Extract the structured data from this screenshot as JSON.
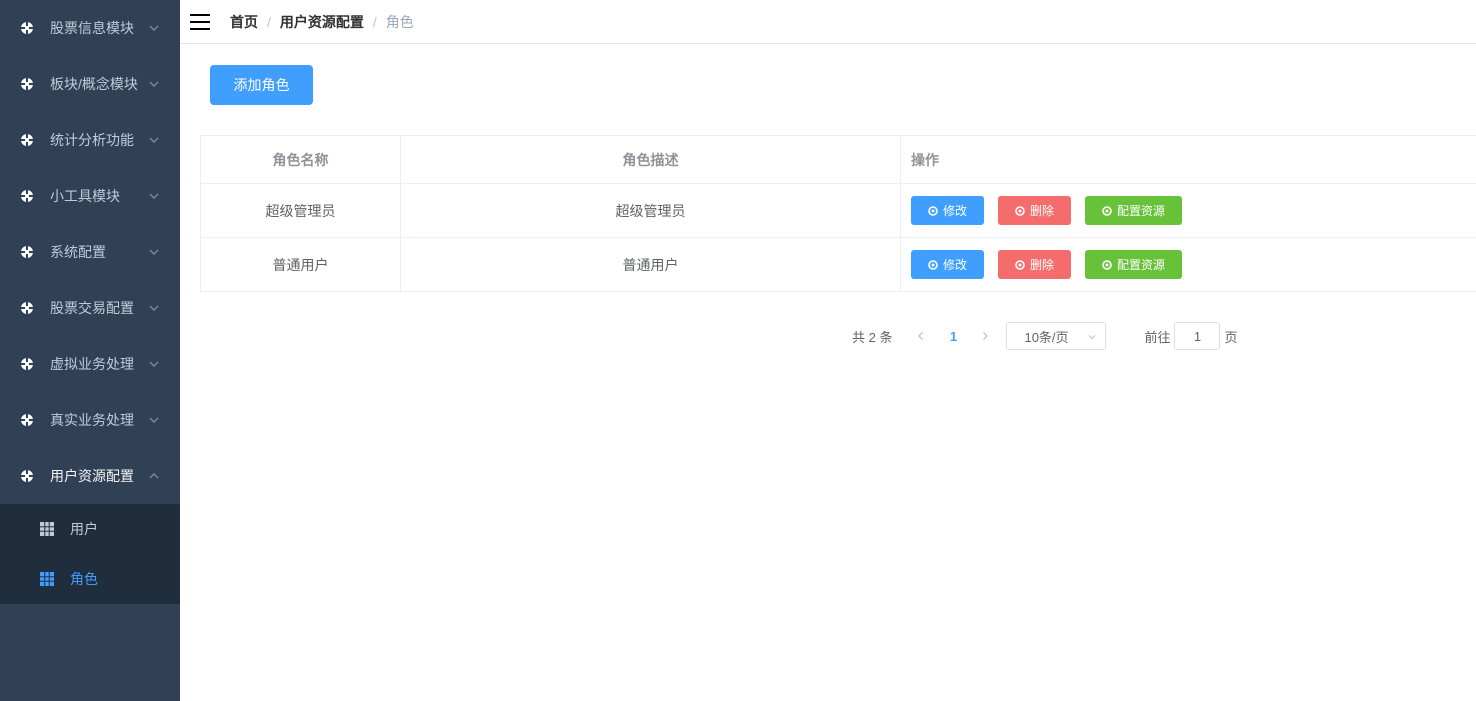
{
  "sidebar": {
    "items": [
      {
        "label": "股票信息模块"
      },
      {
        "label": "板块/概念模块"
      },
      {
        "label": "统计分析功能"
      },
      {
        "label": "小工具模块"
      },
      {
        "label": "系统配置"
      },
      {
        "label": "股票交易配置"
      },
      {
        "label": "虚拟业务处理"
      },
      {
        "label": "真实业务处理"
      },
      {
        "label": "用户资源配置"
      }
    ],
    "submenu": [
      {
        "label": "用户"
      },
      {
        "label": "角色"
      }
    ],
    "active_item": "用户资源配置",
    "active_subitem": "角色"
  },
  "header": {
    "breadcrumb": [
      "首页",
      "用户资源配置",
      "角色"
    ],
    "separator": "/"
  },
  "main": {
    "add_button": "添加角色",
    "table": {
      "columns": [
        "角色名称",
        "角色描述",
        "操作"
      ],
      "rows": [
        {
          "name": "超级管理员",
          "description": "超级管理员"
        },
        {
          "name": "普通用户",
          "description": "普通用户"
        }
      ],
      "actions": {
        "edit": "修改",
        "delete": "删除",
        "resources": "配置资源"
      }
    },
    "pagination": {
      "total": "共 2 条",
      "current_page": "1",
      "page_size": "10条/页",
      "goto_prefix": "前往",
      "goto_value": "1",
      "goto_suffix": "页"
    }
  },
  "colors": {
    "sidebar_bg": "#304156",
    "submenu_bg": "#1f2d3d",
    "primary": "#409eff",
    "danger": "#f56c6c",
    "success": "#67c23a"
  }
}
